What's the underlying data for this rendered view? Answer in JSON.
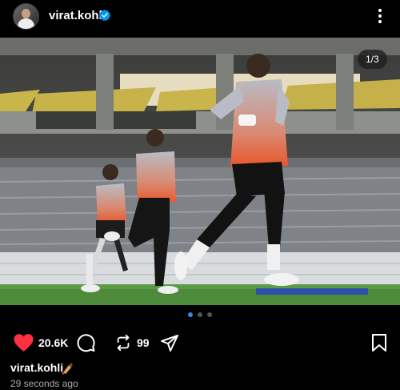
{
  "post": {
    "username": "virat.kohli",
    "image_counter": "1/3",
    "likes": "20.6K",
    "reposts": "99",
    "caption_username": "virat.kohli",
    "caption_emoji": "cricket-bat-emoji",
    "timestamp": "29 seconds ago",
    "carousel": {
      "total": 3,
      "active": 1
    }
  },
  "icons": {
    "verified": "verified-badge-icon",
    "more": "more-options-icon",
    "like": "heart-icon",
    "comment": "comment-icon",
    "repost": "repost-icon",
    "share": "send-icon",
    "save": "bookmark-icon"
  },
  "colors": {
    "background": "#000000",
    "like_red": "#ff3040",
    "verified_blue": "#0095f6",
    "active_dot": "#3b82f6"
  }
}
